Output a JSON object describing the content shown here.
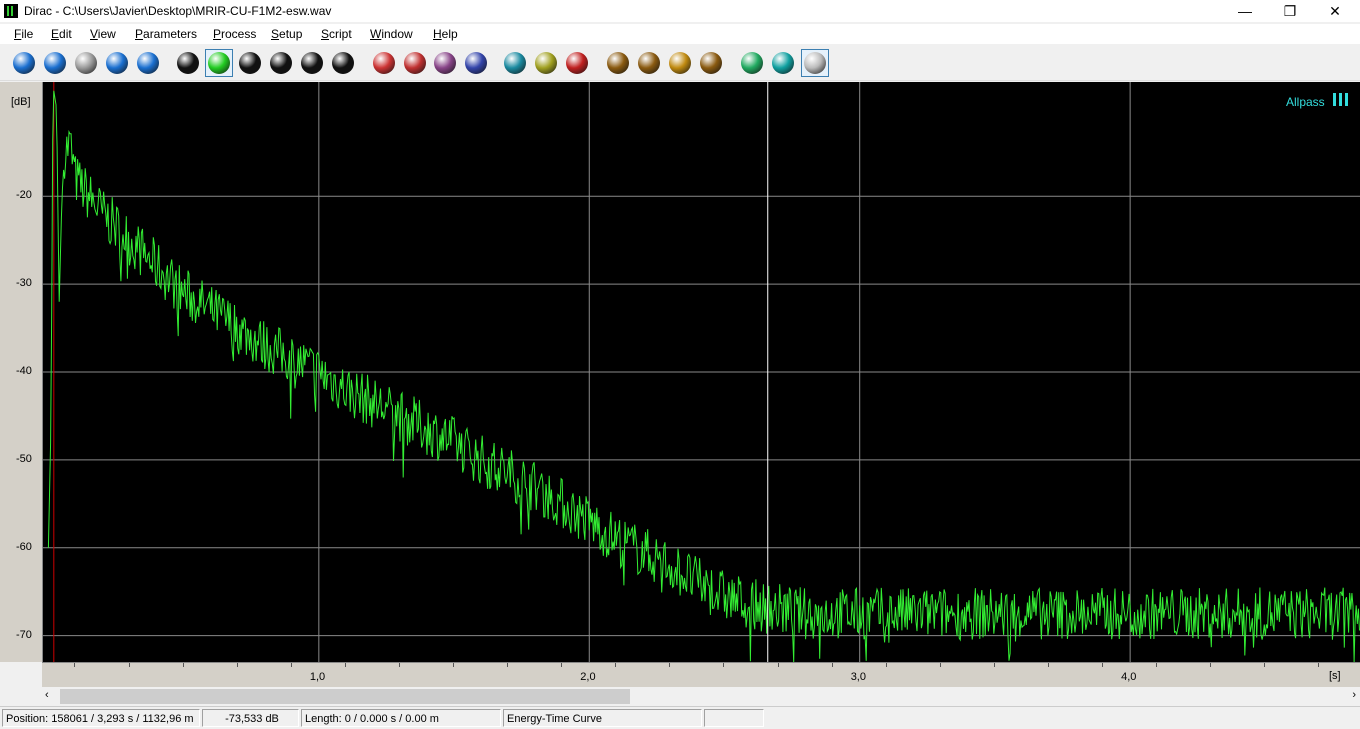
{
  "window": {
    "title": "Dirac - C:\\Users\\Javier\\Desktop\\MRIR-CU-F1M2-esw.wav",
    "minimize": "—",
    "maximize": "❐",
    "close": "✕"
  },
  "menu": [
    "File",
    "Edit",
    "View",
    "Parameters",
    "Process",
    "Setup",
    "Script",
    "Window",
    "Help"
  ],
  "toolbar": [
    {
      "name": "new-file-icon",
      "color": "#1a6fd0"
    },
    {
      "name": "open-file-icon",
      "color": "#1a6fd0"
    },
    {
      "name": "save-icon",
      "color": "#9a9a9a"
    },
    {
      "name": "print-icon",
      "color": "#1a6fd0"
    },
    {
      "name": "close-file-icon",
      "color": "#1a6fd0"
    },
    {
      "name": "impulse-response-icon",
      "color": "#111111"
    },
    {
      "name": "energy-time-curve-icon",
      "color": "#22cc22"
    },
    {
      "name": "decay-curve-icon",
      "color": "#111111"
    },
    {
      "name": "schroeder-curve-icon",
      "color": "#111111"
    },
    {
      "name": "filter-bank-icon",
      "color": "#111111"
    },
    {
      "name": "phase-icon",
      "color": "#111111"
    },
    {
      "name": "spectrum-icon",
      "color": "#cc3333"
    },
    {
      "name": "magnet-icon",
      "color": "#c03030"
    },
    {
      "name": "table-icon",
      "color": "#884488"
    },
    {
      "name": "frequency-response-icon",
      "color": "#3344aa"
    },
    {
      "name": "cursor-icon",
      "color": "#1a8aa0"
    },
    {
      "name": "parameters-icon",
      "color": "#a0a020"
    },
    {
      "name": "pointer-icon",
      "color": "#c02020"
    },
    {
      "name": "zoom-in-icon",
      "color": "#8a5a10"
    },
    {
      "name": "zoom-out-icon",
      "color": "#8a5a10"
    },
    {
      "name": "zoom-full-icon",
      "color": "#c08a10"
    },
    {
      "name": "zoom-vertical-icon",
      "color": "#8a5a10"
    },
    {
      "name": "record-icon",
      "color": "#20aa60"
    },
    {
      "name": "play-icon",
      "color": "#10a0a0"
    },
    {
      "name": "stop-icon",
      "color": "#bbbbbb"
    }
  ],
  "plot": {
    "ylabel": "[dB]",
    "xlabel": "[s]",
    "filter_label": "Allpass",
    "filter_icon": "bars-icon",
    "curve_color": "#33ee33",
    "accent_color": "#33dddd"
  },
  "chart_data": {
    "type": "line",
    "title": "",
    "xlabel": "[s]",
    "ylabel": "[dB]",
    "xlim": [
      -0.02,
      4.85
    ],
    "ylim": [
      -73,
      -7
    ],
    "x_ticks": [
      "1,0",
      "2,0",
      "3,0",
      "4,0"
    ],
    "y_ticks": [
      "-20",
      "-30",
      "-40",
      "-50",
      "-60",
      "-70"
    ],
    "cursor_x": 2.66,
    "marker_x": 0.02,
    "grid": true,
    "series": [
      {
        "x": [
          0.0,
          0.01,
          0.015,
          0.02,
          0.03,
          0.04,
          0.05,
          0.06,
          0.08,
          0.1,
          0.15,
          0.2,
          0.3,
          0.4,
          0.5,
          0.6,
          0.7,
          0.8,
          0.9,
          1.0,
          1.1,
          1.2,
          1.3,
          1.4,
          1.5,
          1.6,
          1.7,
          1.8,
          1.9,
          2.0,
          2.1,
          2.2,
          2.3,
          2.4,
          2.5,
          2.6,
          2.7,
          2.8,
          2.9,
          3.0,
          3.2,
          3.4,
          3.6,
          3.8,
          4.0,
          4.2,
          4.4,
          4.6,
          4.85
        ],
        "values": [
          -60,
          -45,
          -15,
          -8,
          -10,
          -32,
          -20,
          -15,
          -14,
          -18,
          -20,
          -22,
          -25,
          -28,
          -31,
          -33,
          -35,
          -37,
          -38.5,
          -40,
          -42,
          -43.5,
          -45,
          -46.5,
          -48,
          -50,
          -51.5,
          -53,
          -55,
          -57,
          -59,
          -60.5,
          -62,
          -64,
          -65.5,
          -66.5,
          -67,
          -67.5,
          -67.5,
          -67.5,
          -67.5,
          -67.5,
          -67.5,
          -67.5,
          -67.5,
          -67.5,
          -67.5,
          -67.5,
          -67.5
        ]
      }
    ]
  },
  "status": {
    "position": "Position: 158061 / 3,293 s / 1132,96 m",
    "level": "-73,533 dB",
    "length": "Length: 0 / 0.000 s / 0.00 m",
    "view": "Energy-Time Curve",
    "extra": ""
  }
}
